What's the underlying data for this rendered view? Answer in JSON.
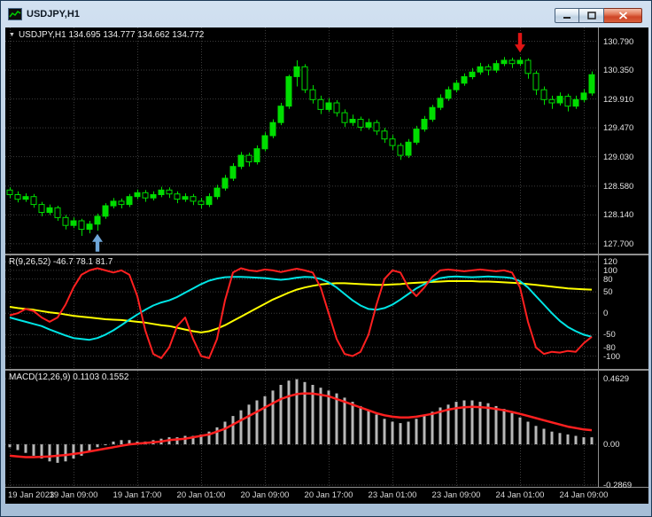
{
  "window": {
    "title": "USDJPY,H1",
    "controls": {
      "minimize": "minimize",
      "maximize": "maximize",
      "close": "close"
    }
  },
  "main_panel": {
    "ohlc_label": "USDJPY,H1 134.695 134.777 134.662 134.772"
  },
  "oscillator_panel": {
    "label": "R(9,26,52) -46.7 78.1 81.7"
  },
  "macd_panel": {
    "label": "MACD(12,26,9) 0.1103 0.1552"
  },
  "chart_data": {
    "type": "candlestick",
    "symbol": "USDJPY",
    "timeframe": "H1",
    "colors": {
      "background": "#000000",
      "grid": "#3c3c3c",
      "candle": "#00dd00",
      "histogram": "#b8b8b8",
      "signal": "#ff2020",
      "buy_arrow": "#6ea6d8",
      "sell_arrow": "#e01414"
    },
    "main": {
      "ylim": [
        127.55,
        131.0
      ],
      "price_axis": [
        "130.790",
        "130.350",
        "129.910",
        "129.470",
        "129.030",
        "128.580",
        "128.140",
        "127.700"
      ],
      "candles": [
        [
          128.52,
          128.56,
          128.4,
          128.45
        ],
        [
          128.45,
          128.5,
          128.33,
          128.38
        ],
        [
          128.38,
          128.47,
          128.34,
          128.42
        ],
        [
          128.42,
          128.46,
          128.25,
          128.3
        ],
        [
          128.3,
          128.34,
          128.12,
          128.18
        ],
        [
          128.18,
          128.3,
          128.14,
          128.25
        ],
        [
          128.25,
          128.28,
          128.05,
          128.1
        ],
        [
          128.1,
          128.14,
          127.92,
          127.98
        ],
        [
          127.98,
          128.1,
          127.94,
          128.05
        ],
        [
          128.05,
          128.08,
          127.82,
          127.92
        ],
        [
          127.92,
          128.05,
          127.86,
          128.0
        ],
        [
          128.0,
          128.16,
          127.9,
          128.12
        ],
        [
          128.12,
          128.32,
          128.08,
          128.28
        ],
        [
          128.28,
          128.4,
          128.24,
          128.35
        ],
        [
          128.35,
          128.39,
          128.24,
          128.3
        ],
        [
          128.3,
          128.46,
          128.26,
          128.42
        ],
        [
          128.42,
          128.53,
          128.38,
          128.48
        ],
        [
          128.48,
          128.52,
          128.34,
          128.4
        ],
        [
          128.4,
          128.5,
          128.36,
          128.45
        ],
        [
          128.45,
          128.57,
          128.41,
          128.52
        ],
        [
          128.52,
          128.56,
          128.4,
          128.46
        ],
        [
          128.46,
          128.5,
          128.32,
          128.38
        ],
        [
          128.38,
          128.47,
          128.34,
          128.42
        ],
        [
          128.42,
          128.46,
          128.29,
          128.35
        ],
        [
          128.35,
          128.4,
          128.24,
          128.3
        ],
        [
          128.3,
          128.47,
          128.26,
          128.42
        ],
        [
          128.42,
          128.6,
          128.38,
          128.55
        ],
        [
          128.55,
          128.75,
          128.51,
          128.7
        ],
        [
          128.7,
          128.93,
          128.66,
          128.88
        ],
        [
          128.88,
          129.1,
          128.84,
          129.05
        ],
        [
          129.05,
          129.09,
          128.88,
          128.95
        ],
        [
          128.95,
          129.2,
          128.91,
          129.15
        ],
        [
          129.15,
          129.4,
          129.11,
          129.35
        ],
        [
          129.35,
          129.6,
          129.31,
          129.55
        ],
        [
          129.55,
          129.85,
          129.51,
          129.8
        ],
        [
          129.8,
          130.28,
          129.76,
          130.25
        ],
        [
          130.25,
          130.5,
          130.1,
          130.4
        ],
        [
          130.4,
          130.44,
          130.0,
          130.05
        ],
        [
          130.05,
          130.12,
          129.84,
          129.9
        ],
        [
          129.9,
          129.96,
          129.68,
          129.75
        ],
        [
          129.75,
          129.92,
          129.71,
          129.85
        ],
        [
          129.85,
          129.89,
          129.64,
          129.7
        ],
        [
          129.7,
          129.75,
          129.48,
          129.55
        ],
        [
          129.55,
          129.67,
          129.5,
          129.6
        ],
        [
          129.6,
          129.64,
          129.42,
          129.48
        ],
        [
          129.48,
          129.61,
          129.44,
          129.55
        ],
        [
          129.55,
          129.59,
          129.36,
          129.42
        ],
        [
          129.42,
          129.47,
          129.24,
          129.3
        ],
        [
          129.3,
          129.36,
          129.13,
          129.2
        ],
        [
          129.2,
          129.24,
          128.98,
          129.05
        ],
        [
          129.05,
          129.3,
          129.01,
          129.25
        ],
        [
          129.25,
          129.5,
          129.21,
          129.45
        ],
        [
          129.45,
          129.65,
          129.41,
          129.6
        ],
        [
          129.6,
          129.82,
          129.56,
          129.78
        ],
        [
          129.78,
          129.98,
          129.74,
          129.92
        ],
        [
          129.92,
          130.1,
          129.88,
          130.05
        ],
        [
          130.05,
          130.2,
          130.01,
          130.15
        ],
        [
          130.15,
          130.3,
          130.11,
          130.25
        ],
        [
          130.25,
          130.38,
          130.21,
          130.32
        ],
        [
          130.32,
          130.46,
          130.28,
          130.4
        ],
        [
          130.4,
          130.44,
          130.27,
          130.35
        ],
        [
          130.35,
          130.5,
          130.31,
          130.45
        ],
        [
          130.45,
          130.55,
          130.41,
          130.5
        ],
        [
          130.5,
          130.54,
          130.38,
          130.45
        ],
        [
          130.45,
          130.55,
          130.41,
          130.5
        ],
        [
          130.5,
          130.53,
          130.22,
          130.3
        ],
        [
          130.3,
          130.34,
          129.97,
          130.05
        ],
        [
          130.05,
          130.1,
          129.82,
          129.9
        ],
        [
          129.9,
          129.96,
          129.76,
          129.85
        ],
        [
          129.85,
          130.01,
          129.81,
          129.95
        ],
        [
          129.95,
          129.99,
          129.72,
          129.8
        ],
        [
          129.8,
          129.96,
          129.76,
          129.9
        ],
        [
          129.9,
          130.06,
          129.86,
          130.0
        ],
        [
          130.0,
          130.33,
          129.96,
          130.28
        ]
      ]
    },
    "markers": [
      {
        "name": "buy-arrow",
        "direction": "up",
        "index": 11,
        "price": 127.85,
        "color": "#6ea6d8"
      },
      {
        "name": "sell-arrow",
        "direction": "down",
        "index": 64,
        "price": 130.62,
        "color": "#e01414"
      }
    ],
    "oscillator": {
      "ylim": [
        -130,
        135
      ],
      "levels": [
        120,
        100,
        80,
        50,
        0,
        -50,
        -80,
        -100
      ],
      "series": [
        {
          "name": "yellow-line",
          "color": "#ffff00",
          "values": [
            15,
            12,
            10,
            8,
            5,
            2,
            0,
            -3,
            -6,
            -8,
            -10,
            -12,
            -14,
            -15,
            -16,
            -18,
            -20,
            -22,
            -25,
            -28,
            -30,
            -34,
            -38,
            -42,
            -45,
            -42,
            -36,
            -28,
            -18,
            -8,
            2,
            12,
            22,
            32,
            40,
            48,
            55,
            60,
            64,
            67,
            69,
            70,
            70,
            69,
            68,
            67,
            66,
            66,
            67,
            68,
            70,
            71,
            72,
            73,
            74,
            75,
            75,
            75,
            75,
            74,
            74,
            73,
            72,
            71,
            70,
            68,
            66,
            64,
            62,
            60,
            58,
            57,
            56,
            55
          ]
        },
        {
          "name": "cyan-line",
          "color": "#00e5e5",
          "values": [
            -10,
            -15,
            -20,
            -25,
            -30,
            -38,
            -45,
            -52,
            -58,
            -60,
            -62,
            -58,
            -50,
            -40,
            -28,
            -15,
            -3,
            8,
            18,
            25,
            30,
            38,
            48,
            58,
            68,
            76,
            81,
            84,
            85,
            85,
            84,
            83,
            82,
            80,
            78,
            80,
            83,
            85,
            84,
            80,
            72,
            60,
            45,
            30,
            18,
            10,
            8,
            12,
            20,
            32,
            45,
            58,
            68,
            76,
            82,
            85,
            86,
            85,
            84,
            85,
            86,
            85,
            84,
            82,
            75,
            60,
            40,
            20,
            0,
            -18,
            -32,
            -42,
            -50,
            -55
          ]
        },
        {
          "name": "red-line",
          "color": "#ff2020",
          "values": [
            -5,
            0,
            10,
            5,
            -10,
            -20,
            -10,
            20,
            60,
            90,
            100,
            105,
            100,
            95,
            100,
            90,
            40,
            -40,
            -95,
            -105,
            -80,
            -30,
            -10,
            -60,
            -100,
            -105,
            -60,
            30,
            95,
            105,
            100,
            98,
            102,
            100,
            96,
            100,
            104,
            100,
            95,
            60,
            0,
            -60,
            -95,
            -100,
            -90,
            -50,
            20,
            80,
            100,
            95,
            60,
            40,
            60,
            85,
            100,
            102,
            100,
            98,
            100,
            102,
            100,
            98,
            100,
            95,
            60,
            -20,
            -80,
            -95,
            -90,
            -92,
            -88,
            -90,
            -70,
            -55
          ]
        }
      ]
    },
    "macd": {
      "ylim": [
        -0.3,
        0.52
      ],
      "axis": [
        {
          "label": "0.4629",
          "value": 0.4629
        },
        {
          "label": "0.00",
          "value": 0.0
        },
        {
          "label": "-0.2869",
          "value": -0.2869
        }
      ],
      "histogram": [
        -0.02,
        -0.04,
        -0.06,
        -0.08,
        -0.1,
        -0.12,
        -0.13,
        -0.12,
        -0.1,
        -0.08,
        -0.05,
        -0.02,
        0.0,
        0.02,
        0.03,
        0.03,
        0.02,
        0.02,
        0.03,
        0.04,
        0.05,
        0.05,
        0.06,
        0.06,
        0.07,
        0.09,
        0.12,
        0.16,
        0.2,
        0.24,
        0.28,
        0.31,
        0.34,
        0.38,
        0.42,
        0.45,
        0.46,
        0.44,
        0.42,
        0.4,
        0.38,
        0.36,
        0.33,
        0.3,
        0.27,
        0.24,
        0.21,
        0.18,
        0.16,
        0.15,
        0.16,
        0.18,
        0.2,
        0.23,
        0.26,
        0.28,
        0.3,
        0.31,
        0.31,
        0.3,
        0.29,
        0.27,
        0.25,
        0.22,
        0.19,
        0.16,
        0.13,
        0.11,
        0.09,
        0.08,
        0.07,
        0.06,
        0.05,
        0.05
      ],
      "signal": [
        -0.08,
        -0.085,
        -0.09,
        -0.09,
        -0.088,
        -0.085,
        -0.08,
        -0.075,
        -0.068,
        -0.06,
        -0.05,
        -0.04,
        -0.03,
        -0.02,
        -0.01,
        0.0,
        0.005,
        0.01,
        0.015,
        0.02,
        0.03,
        0.035,
        0.04,
        0.05,
        0.06,
        0.07,
        0.09,
        0.11,
        0.14,
        0.17,
        0.2,
        0.23,
        0.26,
        0.29,
        0.32,
        0.34,
        0.355,
        0.36,
        0.358,
        0.35,
        0.34,
        0.32,
        0.3,
        0.28,
        0.26,
        0.24,
        0.22,
        0.205,
        0.195,
        0.19,
        0.19,
        0.195,
        0.205,
        0.215,
        0.23,
        0.245,
        0.255,
        0.262,
        0.265,
        0.263,
        0.258,
        0.25,
        0.24,
        0.228,
        0.215,
        0.2,
        0.185,
        0.17,
        0.155,
        0.14,
        0.125,
        0.115,
        0.105,
        0.1
      ]
    },
    "time_axis": {
      "labels": [
        "19 Jan 2023",
        "19 Jan 09:00",
        "19 Jan 17:00",
        "20 Jan 01:00",
        "20 Jan 09:00",
        "20 Jan 17:00",
        "23 Jan 01:00",
        "23 Jan 09:00",
        "24 Jan 01:00",
        "24 Jan 09:00"
      ],
      "indices": [
        0,
        8,
        16,
        24,
        32,
        40,
        48,
        56,
        64,
        72
      ]
    }
  }
}
